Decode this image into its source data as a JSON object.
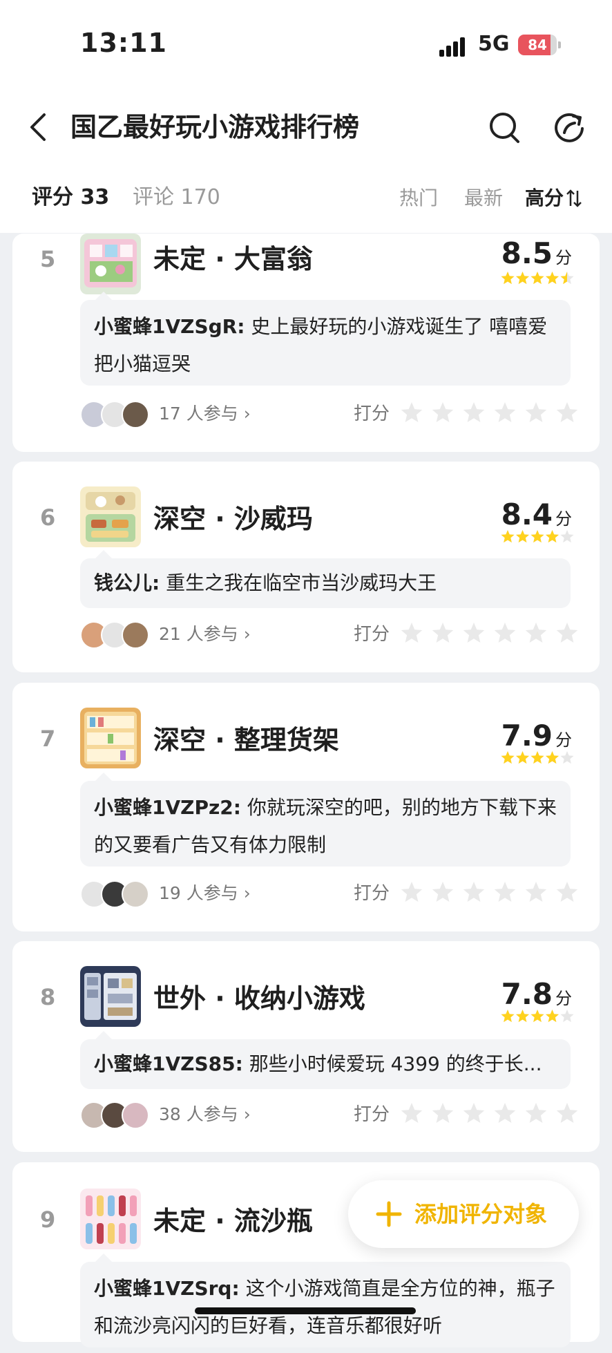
{
  "status": {
    "time": "13:11",
    "network": "5G",
    "battery": "84",
    "battery_level": 0.84
  },
  "header": {
    "title": "国乙最好玩小游戏排行榜"
  },
  "tabs": {
    "score": "评分 33",
    "comments": "评论 170"
  },
  "sort": {
    "hot": "热门",
    "new": "最新",
    "high": "高分"
  },
  "colors": {
    "star": "#ffd21e",
    "accent": "#f0b400",
    "rank": "#9a9a9a"
  },
  "items": [
    {
      "rank": "5",
      "name": "未定 · 大富翁",
      "score": "8.5",
      "unit": "分",
      "stars": 4.5,
      "comment_user": "小蜜蜂1VZSgR:",
      "comment_text": "史上最好玩的小游戏诞生了 嘻嘻爱把小猫逗哭",
      "participants": "17 人参与 ›",
      "rate_label": "打分"
    },
    {
      "rank": "6",
      "name": "深空 · 沙威玛",
      "score": "8.4",
      "unit": "分",
      "stars": 4,
      "comment_user": "钱公儿:",
      "comment_text": "重生之我在临空市当沙威玛大王",
      "participants": "21 人参与 ›",
      "rate_label": "打分"
    },
    {
      "rank": "7",
      "name": "深空 · 整理货架",
      "score": "7.9",
      "unit": "分",
      "stars": 4,
      "comment_user": "小蜜蜂1VZPz2:",
      "comment_text": "你就玩深空的吧，别的地方下载下来的又要看广告又有体力限制",
      "participants": "19 人参与 ›",
      "rate_label": "打分"
    },
    {
      "rank": "8",
      "name": "世外 · 收纳小游戏",
      "score": "7.8",
      "unit": "分",
      "stars": 4,
      "comment_user": "小蜜蜂1VZS85:",
      "comment_text": "那些小时候爱玩 4399 的终于长...",
      "participants": "38 人参与 ›",
      "rate_label": "打分"
    },
    {
      "rank": "9",
      "name": "未定 · 流沙瓶",
      "score": "",
      "unit": "",
      "stars": 0,
      "comment_user": "小蜜蜂1VZSrq:",
      "comment_text": "这个小游戏简直是全方位的神，瓶子和流沙亮闪闪的巨好看，连音乐都很好听",
      "participants": "",
      "rate_label": ""
    }
  ],
  "fab": {
    "label": "添加评分对象",
    "icon": "plus-icon"
  }
}
